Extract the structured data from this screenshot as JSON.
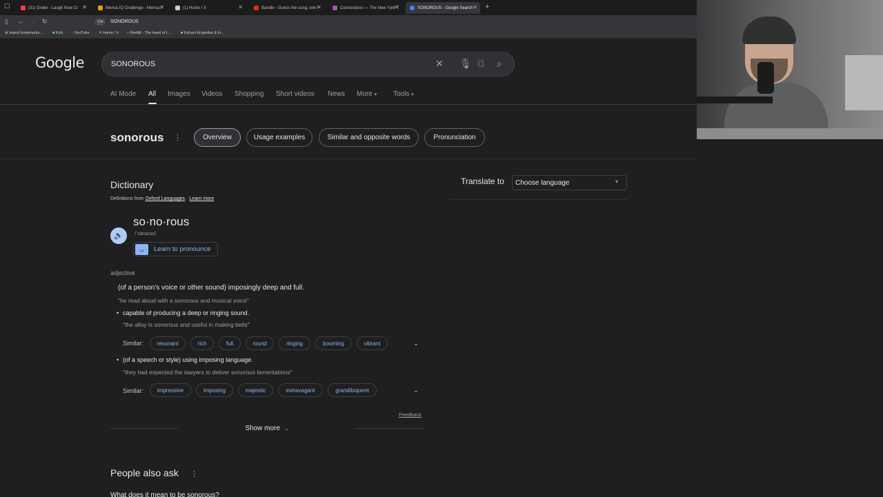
{
  "browser": {
    "tabs": [
      {
        "label": "(31) Drake - Laugh Now Cr",
        "color": "#ff3d3d"
      },
      {
        "label": "Mensa IQ Challenge - Mensa I",
        "color": "#e6a100"
      },
      {
        "label": "(1) Home / X",
        "color": "#cccccc"
      },
      {
        "label": "Bandle - Guess the song, one i",
        "color": "#d93025"
      },
      {
        "label": "Connections — The New York T",
        "color": "#9b59b6"
      },
      {
        "label": "SONOROUS - Google Search",
        "color": "#4285f4"
      }
    ],
    "new_tab": "+",
    "url": "SONOROUS",
    "bookmarks": [
      {
        "label": "Import bookmarks..."
      },
      {
        "label": "Kick"
      },
      {
        "label": "YouTube"
      },
      {
        "label": "Home / X"
      },
      {
        "label": "Reddit - The heart of t..."
      },
      {
        "label": "Extract Acapellas & In..."
      }
    ]
  },
  "google": {
    "logo": "Google",
    "query": "SONOROUS",
    "nav": [
      "AI Mode",
      "All",
      "Images",
      "Videos",
      "Shopping",
      "Short videos",
      "News",
      "More",
      "Tools"
    ],
    "active_nav": "All"
  },
  "term": {
    "word": "sonorous",
    "chips": [
      "Overview",
      "Usage examples",
      "Similar and opposite words",
      "Pronunciation"
    ]
  },
  "dictionary": {
    "title": "Dictionary",
    "from_prefix": "Definitions from ",
    "source": "Oxford Languages",
    "learn_more": "Learn more",
    "headword": "so·no·rous",
    "phonetic": "/ˈsänərəs/",
    "learn_pronounce": "Learn to pronounce",
    "pos": "adjective",
    "senses": [
      {
        "definition": "(of a person's voice or other sound) imposingly deep and full.",
        "example": "\"he read aloud with a sonorous and musical voice\""
      },
      {
        "definition": "capable of producing a deep or ringing sound.",
        "example": "\"the alloy is sonorous and useful in making bells\"",
        "similar_label": "Similar:",
        "similar": [
          "resonant",
          "rich",
          "full",
          "round",
          "ringing",
          "booming",
          "vibrant"
        ]
      },
      {
        "definition": "(of a speech or style) using imposing language.",
        "example": "\"they had expected the lawyers to deliver sonorous lamentations\"",
        "similar_label": "Similar:",
        "similar": [
          "impressive",
          "imposing",
          "majestic",
          "extravagant",
          "grandiloquent"
        ]
      }
    ],
    "feedback": "Feedback",
    "show_more": "Show more"
  },
  "people_also_ask": {
    "title": "People also ask",
    "first_question": "What does it mean to be sonorous?"
  },
  "translate": {
    "label": "Translate to",
    "value": "Choose language"
  },
  "colors": {
    "page_bg": "#1f1f1f",
    "link": "#8ab4f8",
    "text": "#e8e8e8",
    "muted": "#9aa0a6"
  }
}
